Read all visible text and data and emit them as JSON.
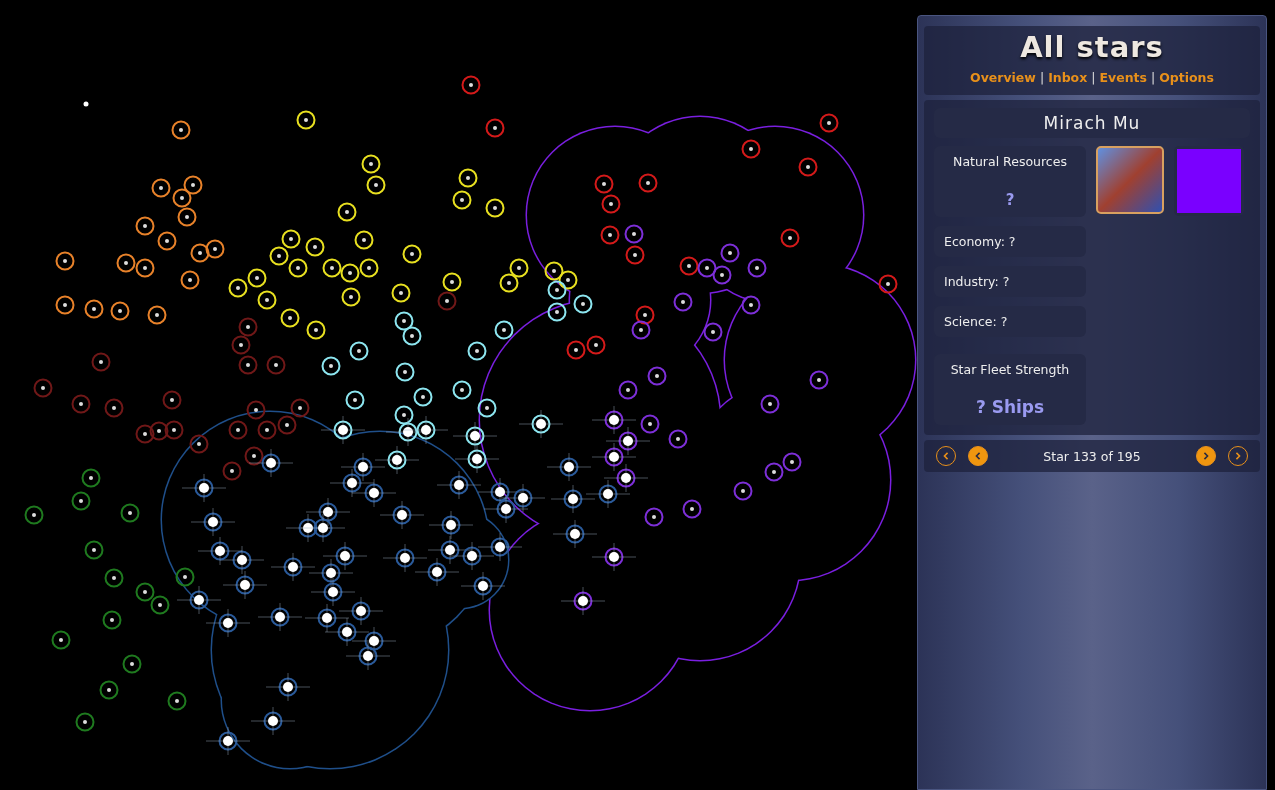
{
  "panel": {
    "title": "All stars",
    "nav": {
      "separator": "|",
      "links": [
        {
          "label": "Overview"
        },
        {
          "label": "Inbox"
        },
        {
          "label": "Events"
        },
        {
          "label": "Options"
        }
      ]
    }
  },
  "star": {
    "name": "Mirach Mu",
    "images": [
      {
        "kind": "photo"
      },
      {
        "kind": "swatch",
        "color": "#7a00ff"
      }
    ],
    "natural_resources": {
      "label": "Natural Resources",
      "value": "?"
    },
    "stats": [
      {
        "text": "Economy: ?"
      },
      {
        "text": "Industry: ?"
      },
      {
        "text": "Science: ?"
      }
    ],
    "fleet": {
      "label": "Star Fleet Strength",
      "value": "? Ships"
    }
  },
  "pager": {
    "text": "Star 133 of 195"
  }
}
